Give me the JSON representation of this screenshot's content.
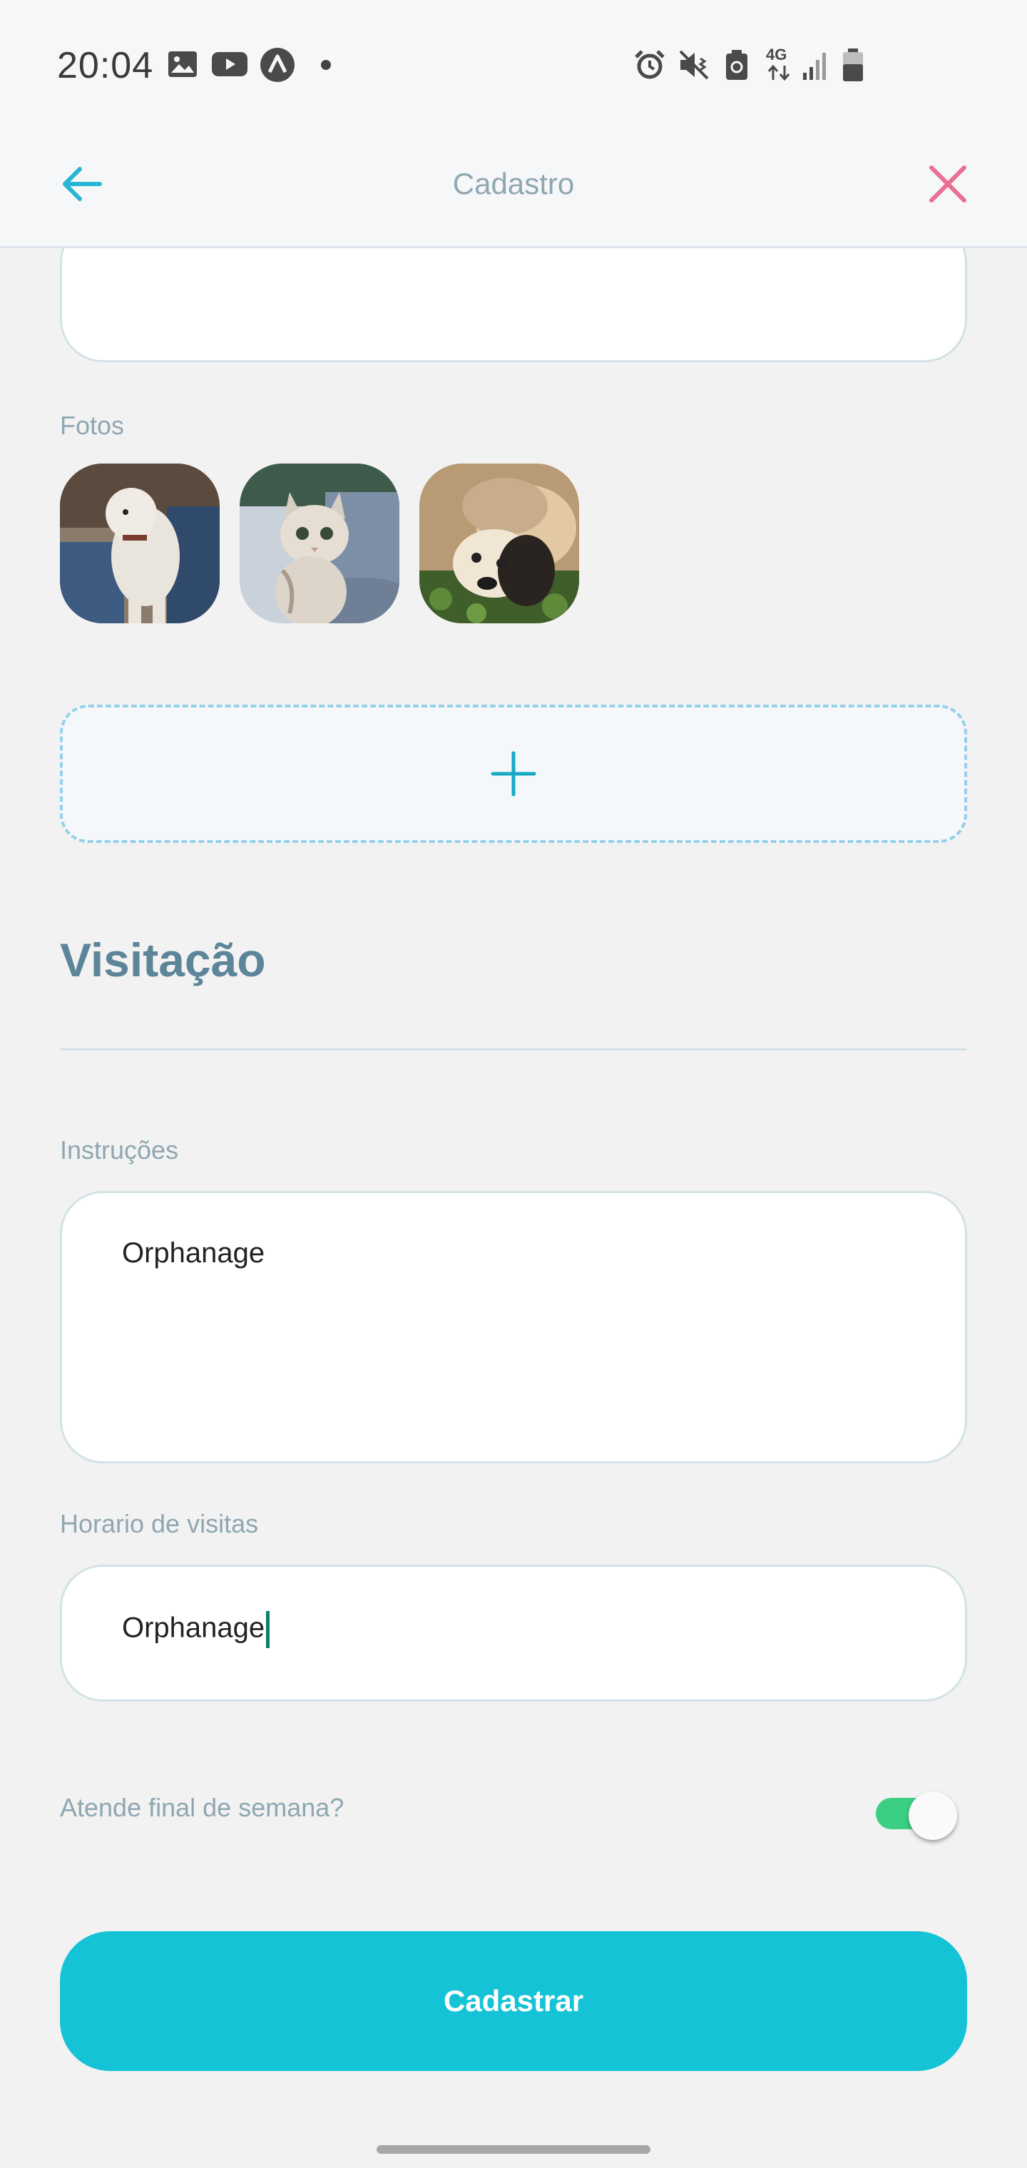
{
  "status_bar": {
    "time": "20:04",
    "network": "4G"
  },
  "app_bar": {
    "title": "Cadastro",
    "back_icon": "arrow-left-icon",
    "close_icon": "close-icon",
    "accent_color": "#29b6d6",
    "close_color": "#ea6f92"
  },
  "photos": {
    "label": "Fotos",
    "items": [
      "dog-photo",
      "kitten-photo",
      "cat-and-dog-photo"
    ],
    "add_icon": "plus-icon"
  },
  "visitacao": {
    "title": "Visitação",
    "instructions": {
      "label": "Instruções",
      "value": "Orphanage"
    },
    "hours": {
      "label": "Horario de visitas",
      "value": "Orphanage"
    },
    "weekend": {
      "label": "Atende final de semana?",
      "enabled": true
    }
  },
  "submit": {
    "label": "Cadastrar",
    "color": "#15c3d6"
  }
}
